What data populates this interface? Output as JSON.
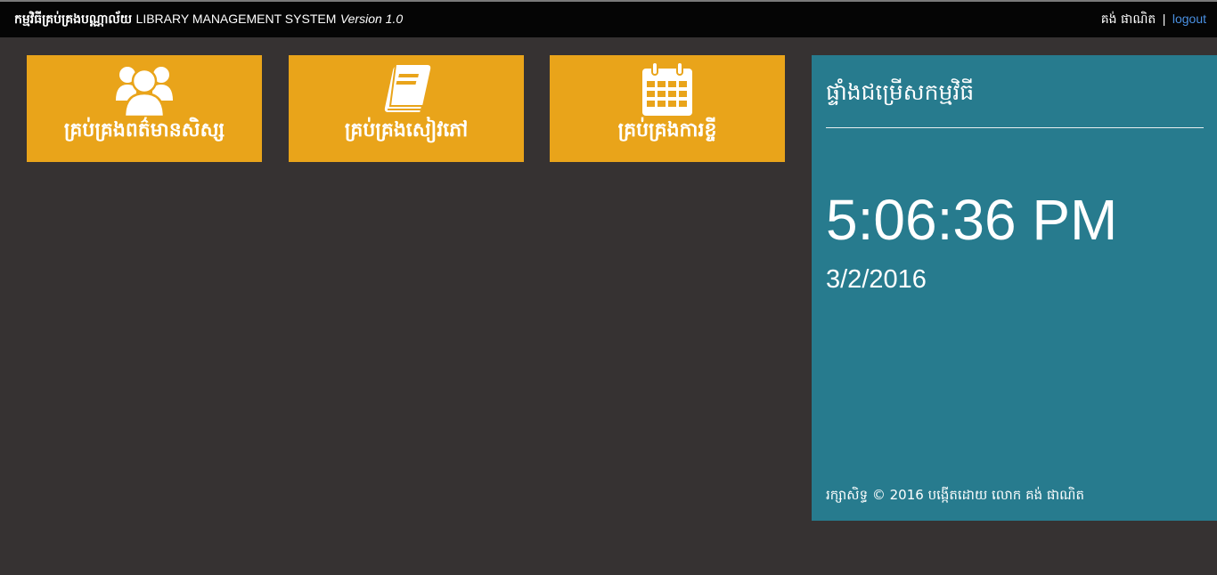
{
  "header": {
    "title_kh": "កម្មវិធីគ្រប់គ្រងបណ្ណាល័យ",
    "title_en": "LIBRARY MANAGEMENT SYSTEM",
    "version": "Version 1.0",
    "user_name": "គង់ ផាណិត",
    "separator": "|",
    "logout_label": "logout"
  },
  "tiles": [
    {
      "label": "គ្រប់គ្រងពត៌មានសិស្ស",
      "icon": "users-icon"
    },
    {
      "label": "គ្រប់គ្រងសៀវភៅ",
      "icon": "book-icon"
    },
    {
      "label": "គ្រប់គ្រងការខ្ចី",
      "icon": "calendar-icon"
    }
  ],
  "panel": {
    "title": "ផ្ទាំងជម្រើសកម្មវិធី",
    "time": "5:06:36 PM",
    "date": "3/2/2016",
    "footer": "រក្សាសិទ្ធ © 2016 បង្កើតដោយ លោក គង់ ផាណិត"
  },
  "colors": {
    "background": "#363232",
    "topbar": "#050505",
    "tile": "#e9a41a",
    "panel": "#277b8e",
    "logout_link": "#4a90e2"
  }
}
